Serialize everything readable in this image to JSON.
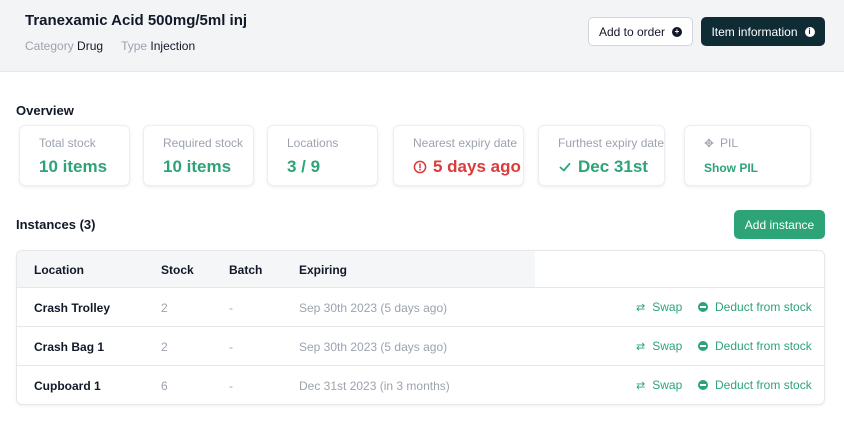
{
  "header": {
    "title": "Tranexamic Acid 500mg/5ml inj",
    "category_label": "Category",
    "category_value": "Drug",
    "type_label": "Type",
    "type_value": "Injection",
    "add_to_order_label": "Add to order",
    "item_information_label": "Item information"
  },
  "overview": {
    "title": "Overview",
    "cards": [
      {
        "label": "Total stock",
        "value": "10 items"
      },
      {
        "label": "Required stock",
        "value": "10 items"
      },
      {
        "label": "Locations",
        "value": "3 / 9"
      },
      {
        "label": "Nearest expiry date",
        "value": "5 days ago"
      },
      {
        "label": "Furthest expiry date",
        "value": "Dec 31st"
      },
      {
        "label": "PIL",
        "value": "Show PIL"
      }
    ]
  },
  "instances": {
    "title": "Instances (3)",
    "add_label": "Add instance",
    "columns": [
      "Location",
      "Stock",
      "Batch",
      "Expiring"
    ],
    "rows": [
      {
        "location": "Crash Trolley",
        "stock": "2",
        "batch": "-",
        "expiring": "Sep 30th 2023 (5 days ago)"
      },
      {
        "location": "Crash Bag 1",
        "stock": "2",
        "batch": "-",
        "expiring": "Sep 30th 2023 (5 days ago)"
      },
      {
        "location": "Cupboard 1",
        "stock": "6",
        "batch": "-",
        "expiring": "Dec 31st 2023 (in 3 months)"
      }
    ],
    "swap_label": "Swap",
    "deduct_label": "Deduct from stock"
  },
  "colors": {
    "accent_green": "#2da477",
    "alert_red": "#dc3b3b",
    "dark_button": "#0f2b33"
  }
}
